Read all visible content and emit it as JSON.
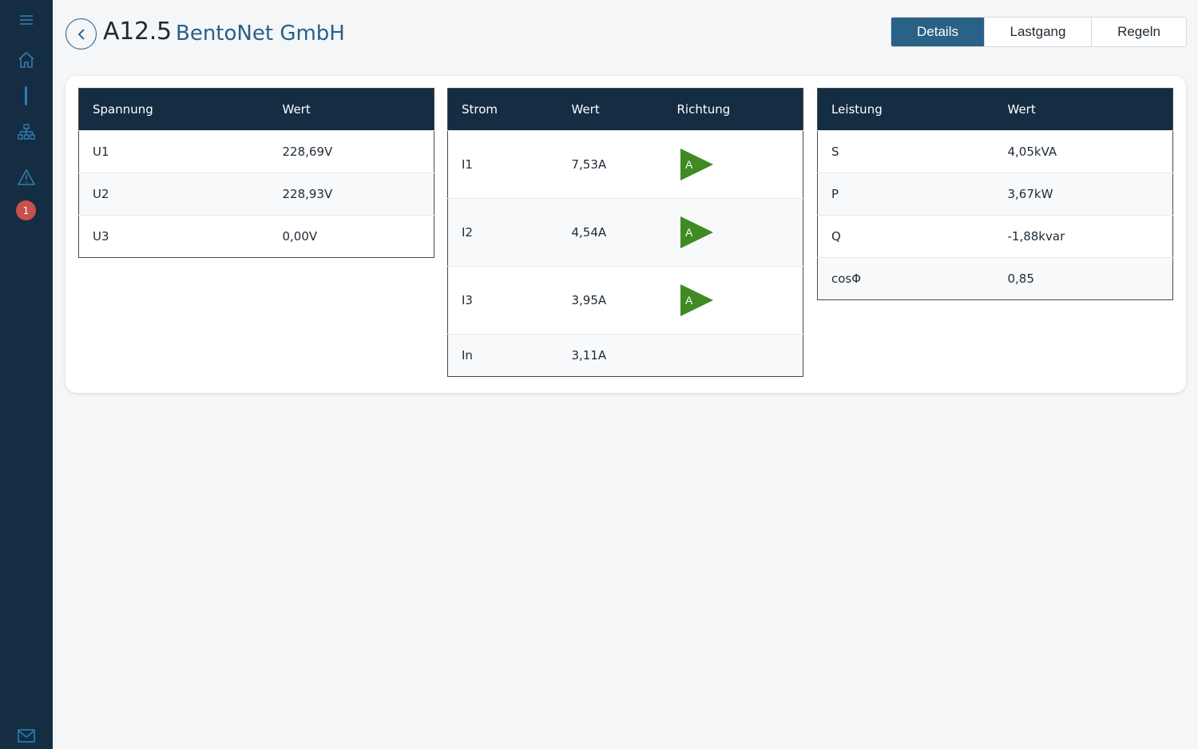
{
  "sidebar": {
    "icons": [
      "menu-icon",
      "home-icon",
      "network-icon",
      "warning-icon",
      "mail-icon"
    ],
    "badge_count": "1"
  },
  "header": {
    "code": "A12.5",
    "name": "BentoNet GmbH"
  },
  "tabs": [
    {
      "label": "Details",
      "active": true
    },
    {
      "label": "Lastgang",
      "active": false
    },
    {
      "label": "Regeln",
      "active": false
    }
  ],
  "spannung": {
    "headers": [
      "Spannung",
      "Wert"
    ],
    "rows": [
      {
        "name": "U1",
        "value": "228,69V"
      },
      {
        "name": "U2",
        "value": "228,93V"
      },
      {
        "name": "U3",
        "value": "0,00V"
      }
    ]
  },
  "strom": {
    "headers": [
      "Strom",
      "Wert",
      "Richtung"
    ],
    "rows": [
      {
        "name": "I1",
        "value": "7,53A",
        "direction": "A"
      },
      {
        "name": "I2",
        "value": "4,54A",
        "direction": "A"
      },
      {
        "name": "I3",
        "value": "3,95A",
        "direction": "A"
      },
      {
        "name": "In",
        "value": "3,11A",
        "direction": ""
      }
    ]
  },
  "leistung": {
    "headers": [
      "Leistung",
      "Wert"
    ],
    "rows": [
      {
        "name": "S",
        "value": "4,05kVA"
      },
      {
        "name": "P",
        "value": "3,67kW"
      },
      {
        "name": "Q",
        "value": "-1,88kvar"
      },
      {
        "name": "cosΦ",
        "value": "0,85"
      }
    ]
  },
  "colors": {
    "sidebar_bg": "#142d42",
    "accent": "#2a6186",
    "direction_green": "#3f8a23",
    "badge_red": "#c9504b"
  }
}
